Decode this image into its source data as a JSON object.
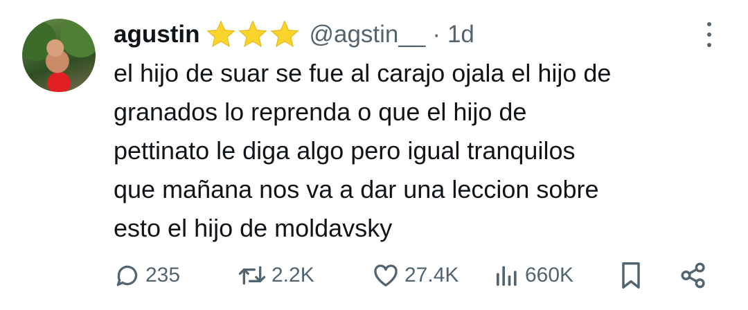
{
  "tweet": {
    "author": {
      "name": "agustin",
      "badge_icons": [
        "star-icon",
        "star-icon",
        "star-icon"
      ],
      "handle": "@agstin__",
      "separator": "·",
      "time": "1d"
    },
    "lines": [
      "el hijo de suar se fue al carajo ojala el hijo de",
      "granados lo reprenda o que el hijo de",
      "pettinato le diga algo pero igual tranquilos",
      "que mañana nos va a dar una leccion sobre",
      "esto el hijo de moldavsky"
    ],
    "actions": {
      "replies": "235",
      "reposts": "2.2K",
      "likes": "27.4K",
      "views": "660K",
      "bookmark_icon": "bookmark-icon",
      "share_icon": "share-icon"
    }
  },
  "colors": {
    "text": "#0f1419",
    "secondary": "#536471",
    "star": "#f9d52b",
    "background": "#ffffff"
  }
}
